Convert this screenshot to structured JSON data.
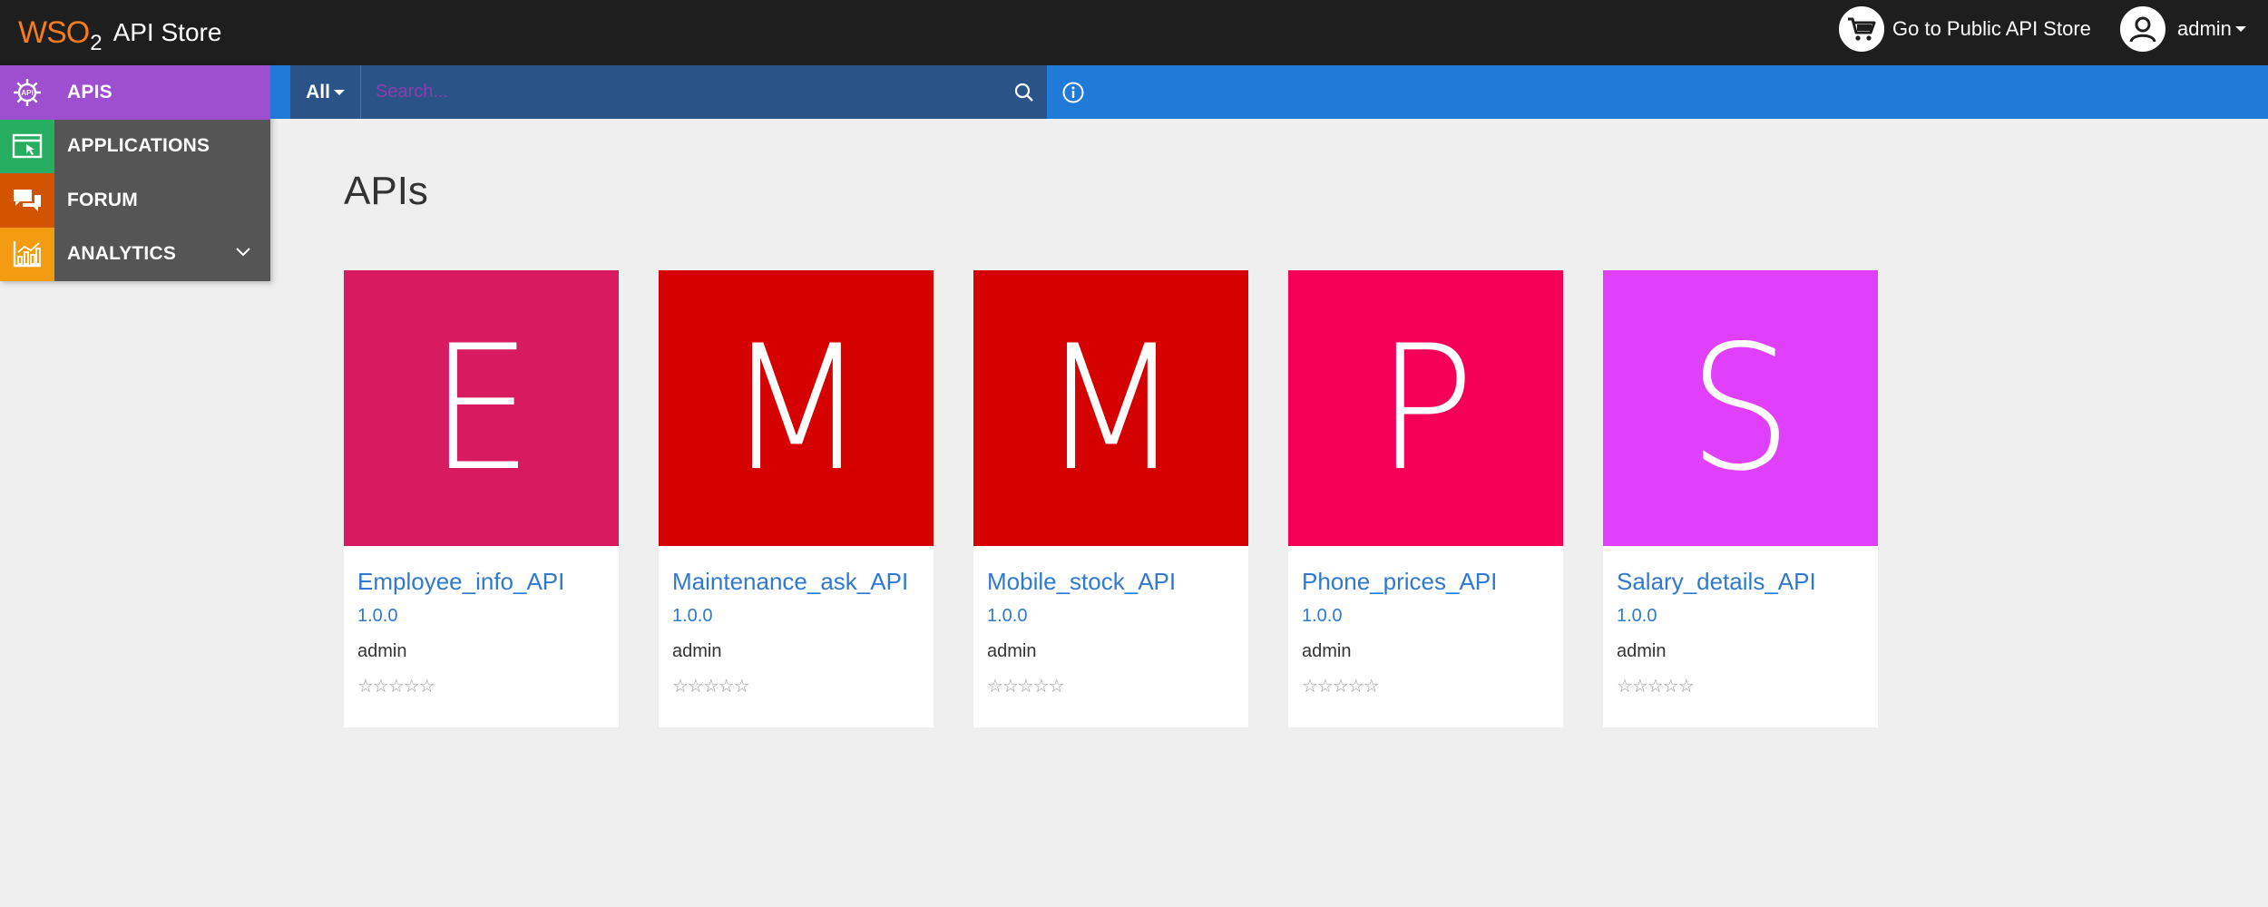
{
  "header": {
    "logo_text": "WSO",
    "logo_subscript": "2",
    "app_title": "API Store",
    "public_store_label": "Go to Public API Store",
    "user_label": "admin",
    "icons": {
      "cart": "cart-icon",
      "user": "user-avatar-icon"
    }
  },
  "sidebar": {
    "items": [
      {
        "label": "APIS",
        "icon": "api-gear-icon",
        "color": "#9e4fcf",
        "active": true
      },
      {
        "label": "APPLICATIONS",
        "icon": "application-window-icon",
        "color": "#27ae60"
      },
      {
        "label": "FORUM",
        "icon": "chat-bubbles-icon",
        "color": "#d35400"
      },
      {
        "label": "ANALYTICS",
        "icon": "bar-chart-icon",
        "color": "#f39c12",
        "expandable": true
      }
    ]
  },
  "search": {
    "scope": "All",
    "placeholder": "Search...",
    "value": ""
  },
  "main": {
    "title": "APIs",
    "apis": [
      {
        "letter": "E",
        "name": "Employee_info_API",
        "version": "1.0.0",
        "owner": "admin",
        "rating": "☆☆☆☆☆",
        "color": "#d81b60"
      },
      {
        "letter": "M",
        "name": "Maintenance_ask_API",
        "version": "1.0.0",
        "owner": "admin",
        "rating": "☆☆☆☆☆",
        "color": "#d50000"
      },
      {
        "letter": "M",
        "name": "Mobile_stock_API",
        "version": "1.0.0",
        "owner": "admin",
        "rating": "☆☆☆☆☆",
        "color": "#d50000"
      },
      {
        "letter": "P",
        "name": "Phone_prices_API",
        "version": "1.0.0",
        "owner": "admin",
        "rating": "☆☆☆☆☆",
        "color": "#f50057"
      },
      {
        "letter": "S",
        "name": "Salary_details_API",
        "version": "1.0.0",
        "owner": "admin",
        "rating": "☆☆☆☆☆",
        "color": "#e040fb"
      }
    ]
  },
  "colors": {
    "header_bg": "#1e1e1e",
    "search_bar_bg": "#1f7ad8",
    "search_group_bg": "#2a5387",
    "link_blue": "#2f7ad0",
    "logo_orange": "#f47b20"
  }
}
